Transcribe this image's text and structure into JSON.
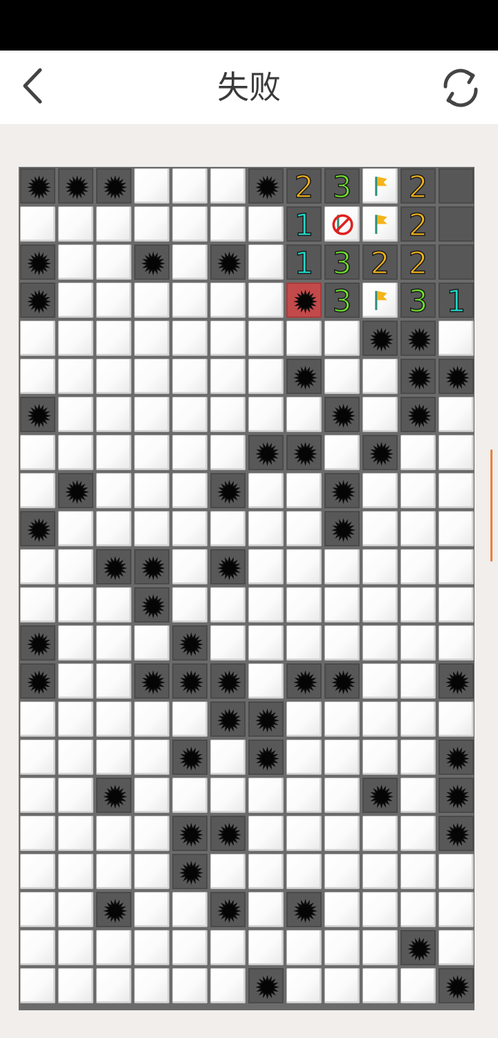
{
  "header": {
    "title": "失败",
    "back_icon": "chevron-left-icon",
    "restart_icon": "refresh-icon"
  },
  "game": {
    "state": "lost",
    "columns": 12,
    "visible_rows": 22,
    "legend": {
      "H": "hidden",
      "M": "mine",
      "X": "exploded-mine",
      "F": "flag",
      "W": "wrong-flag",
      "O": "opened-empty",
      "1": "number-1",
      "2": "number-2",
      "3": "number-3"
    },
    "rows": [
      [
        "M",
        "M",
        "M",
        "H",
        "H",
        "H",
        "M",
        "2",
        "3",
        "F",
        "2",
        "O"
      ],
      [
        "H",
        "H",
        "H",
        "H",
        "H",
        "H",
        "H",
        "1",
        "W",
        "F",
        "2",
        "O"
      ],
      [
        "M",
        "H",
        "H",
        "M",
        "H",
        "M",
        "H",
        "1",
        "3",
        "2",
        "2",
        "O"
      ],
      [
        "M",
        "H",
        "H",
        "H",
        "H",
        "H",
        "H",
        "X",
        "3",
        "F",
        "3",
        "1"
      ],
      [
        "H",
        "H",
        "H",
        "H",
        "H",
        "H",
        "H",
        "H",
        "H",
        "M",
        "M",
        "H"
      ],
      [
        "H",
        "H",
        "H",
        "H",
        "H",
        "H",
        "H",
        "M",
        "H",
        "H",
        "M",
        "M"
      ],
      [
        "M",
        "H",
        "H",
        "H",
        "H",
        "H",
        "H",
        "H",
        "M",
        "H",
        "M",
        "H"
      ],
      [
        "H",
        "H",
        "H",
        "H",
        "H",
        "H",
        "M",
        "M",
        "H",
        "M",
        "H",
        "H"
      ],
      [
        "H",
        "M",
        "H",
        "H",
        "H",
        "M",
        "H",
        "H",
        "M",
        "H",
        "H",
        "H"
      ],
      [
        "M",
        "H",
        "H",
        "H",
        "H",
        "H",
        "H",
        "H",
        "M",
        "H",
        "H",
        "H"
      ],
      [
        "H",
        "H",
        "M",
        "M",
        "H",
        "M",
        "H",
        "H",
        "H",
        "H",
        "H",
        "H"
      ],
      [
        "H",
        "H",
        "H",
        "M",
        "H",
        "H",
        "H",
        "H",
        "H",
        "H",
        "H",
        "H"
      ],
      [
        "M",
        "H",
        "H",
        "H",
        "M",
        "H",
        "H",
        "H",
        "H",
        "H",
        "H",
        "H"
      ],
      [
        "M",
        "H",
        "H",
        "M",
        "M",
        "M",
        "H",
        "M",
        "M",
        "H",
        "H",
        "M"
      ],
      [
        "H",
        "H",
        "H",
        "H",
        "H",
        "M",
        "M",
        "H",
        "H",
        "H",
        "H",
        "H"
      ],
      [
        "H",
        "H",
        "H",
        "H",
        "M",
        "H",
        "M",
        "H",
        "H",
        "H",
        "H",
        "M"
      ],
      [
        "H",
        "H",
        "M",
        "H",
        "H",
        "H",
        "H",
        "H",
        "H",
        "M",
        "H",
        "M"
      ],
      [
        "H",
        "H",
        "H",
        "H",
        "M",
        "M",
        "H",
        "H",
        "H",
        "H",
        "H",
        "M"
      ],
      [
        "H",
        "H",
        "H",
        "H",
        "M",
        "H",
        "H",
        "H",
        "H",
        "H",
        "H",
        "H"
      ],
      [
        "H",
        "H",
        "M",
        "H",
        "H",
        "M",
        "H",
        "M",
        "H",
        "H",
        "H",
        "H"
      ],
      [
        "H",
        "H",
        "H",
        "H",
        "H",
        "H",
        "H",
        "H",
        "H",
        "H",
        "M",
        "H"
      ],
      [
        "H",
        "H",
        "H",
        "H",
        "H",
        "H",
        "M",
        "H",
        "H",
        "H",
        "H",
        "M"
      ]
    ],
    "number_colors": {
      "1": "#22d8c8",
      "2": "#f2b21c",
      "3": "#6fe32c"
    },
    "colors": {
      "flag": "#f4b41a",
      "wrong_flag_mark": "#e02020",
      "exploded_bg": "#c24a4a",
      "accent": "#e98136"
    }
  }
}
